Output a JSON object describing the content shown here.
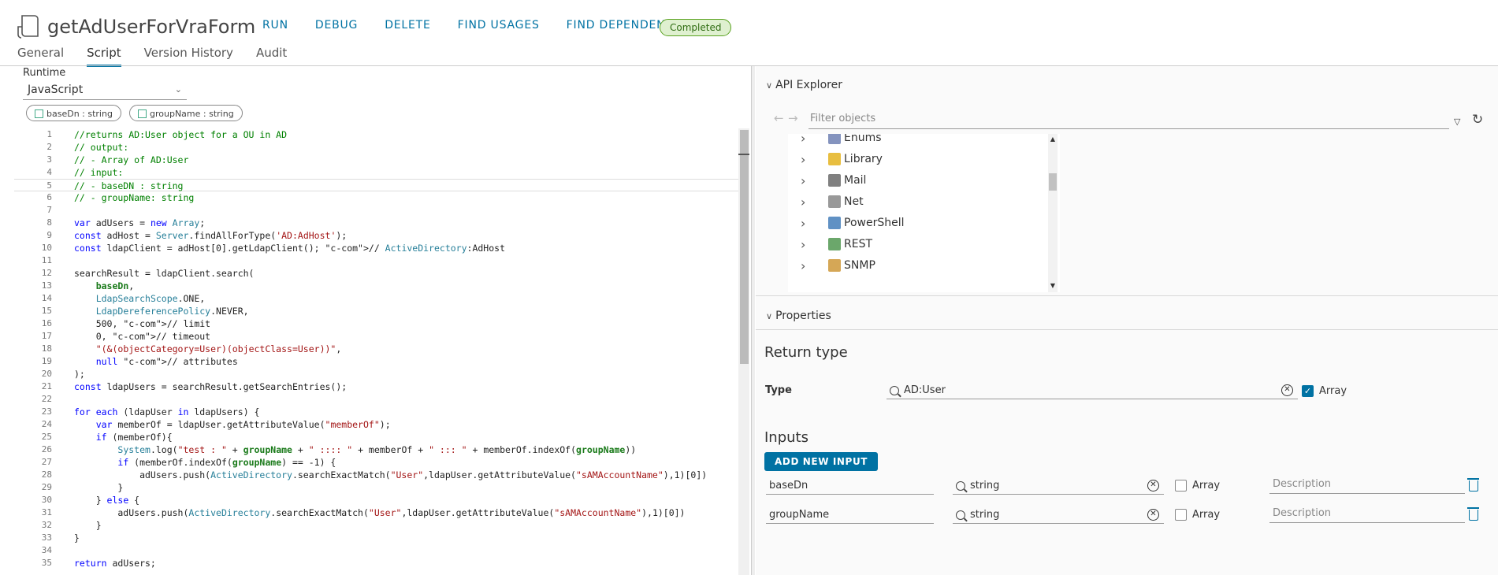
{
  "workflow": {
    "title": "getAdUserForVraForm",
    "icon": "workflow-icon"
  },
  "actions": [
    "RUN",
    "DEBUG",
    "DELETE",
    "FIND USAGES",
    "FIND DEPENDENCIES"
  ],
  "status_badge": "Completed",
  "tabs": [
    {
      "label": "General",
      "active": false
    },
    {
      "label": "Script",
      "active": true
    },
    {
      "label": "Version History",
      "active": false
    },
    {
      "label": "Audit",
      "active": false
    }
  ],
  "runtime": {
    "label": "Runtime",
    "value": "JavaScript"
  },
  "input_chips": [
    "baseDn : string",
    "groupName : string"
  ],
  "code_lines": [
    "//returns AD:User object for a OU in AD",
    "// output:",
    "// - Array of AD:User",
    "// input:",
    "// - baseDN : string",
    "// - groupName: string",
    "",
    "var adUsers = new Array;",
    "const adHost = Server.findAllForType('AD:AdHost');",
    "const ldapClient = adHost[0].getLdapClient(); // ActiveDirectory:AdHost",
    "",
    "searchResult = ldapClient.search(",
    "    baseDn,",
    "    LdapSearchScope.ONE,",
    "    LdapDereferencePolicy.NEVER,",
    "    500, // limit",
    "    0, // timeout",
    "    \"(&(objectCategory=User)(objectClass=User))\",",
    "    null // attributes",
    ");",
    "const ldapUsers = searchResult.getSearchEntries();",
    "",
    "for each (ldapUser in ldapUsers) {",
    "    var memberOf = ldapUser.getAttributeValue(\"memberOf\");",
    "    if (memberOf){",
    "        System.log(\"test : \" + groupName + \" :::: \" + memberOf + \" ::: \" + memberOf.indexOf(groupName))",
    "        if (memberOf.indexOf(groupName) == -1) {",
    "            adUsers.push(ActiveDirectory.searchExactMatch(\"User\",ldapUser.getAttributeValue(\"sAMAccountName\"),1)[0])",
    "        }",
    "    } else {",
    "        adUsers.push(ActiveDirectory.searchExactMatch(\"User\",ldapUser.getAttributeValue(\"sAMAccountName\"),1)[0])",
    "    }",
    "}",
    "",
    "return adUsers;"
  ],
  "api_explorer": {
    "title": "API Explorer",
    "filter_placeholder": "Filter objects",
    "tree_items": [
      {
        "label": "Enums",
        "icon": "enums-icon",
        "color": "#5b6fa8"
      },
      {
        "label": "Library",
        "icon": "library-icon",
        "color": "#e0a800"
      },
      {
        "label": "Mail",
        "icon": "mail-icon",
        "color": "#555555"
      },
      {
        "label": "Net",
        "icon": "net-icon",
        "color": "#777777"
      },
      {
        "label": "PowerShell",
        "icon": "powershell-icon",
        "color": "#2b6cb0"
      },
      {
        "label": "REST",
        "icon": "rest-icon",
        "color": "#3a8a3a"
      },
      {
        "label": "SNMP",
        "icon": "snmp-icon",
        "color": "#c78a1e"
      }
    ]
  },
  "properties": {
    "title": "Properties",
    "return_type_heading": "Return type",
    "type_label": "Type",
    "type_value": "AD:User",
    "type_array_label": "Array",
    "type_array_checked": true,
    "inputs_heading": "Inputs",
    "add_input_label": "ADD NEW INPUT",
    "inputs": [
      {
        "name": "baseDn",
        "type": "string",
        "array_label": "Array",
        "array_checked": false,
        "description_placeholder": "Description"
      },
      {
        "name": "groupName",
        "type": "string",
        "array_label": "Array",
        "array_checked": false,
        "description_placeholder": "Description"
      }
    ]
  },
  "colors": {
    "accent": "#0072a3",
    "badge_bg": "#dff0d0",
    "badge_border": "#5aa220"
  }
}
